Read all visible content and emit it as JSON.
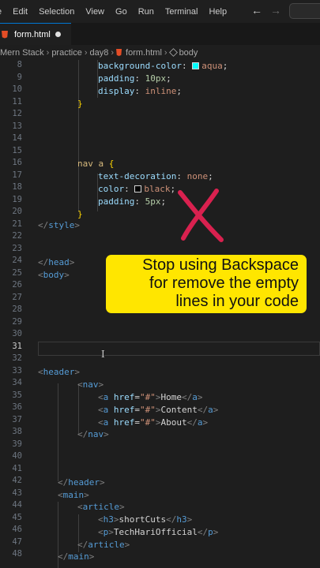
{
  "menu": {
    "items": [
      "e",
      "Edit",
      "Selection",
      "View",
      "Go",
      "Run",
      "Terminal",
      "Help"
    ],
    "back_icon": "arrow-left-icon",
    "forward_icon": "arrow-right-icon"
  },
  "tab": {
    "title": "form.html",
    "icon": "html5-icon",
    "modified": true
  },
  "breadcrumb": {
    "segments": [
      "Mern Stack",
      "practice",
      "day8",
      "form.html",
      "body"
    ]
  },
  "editor": {
    "active_line": 31,
    "line_numbers": [
      8,
      9,
      10,
      11,
      12,
      13,
      14,
      15,
      16,
      17,
      18,
      19,
      20,
      21,
      22,
      23,
      24,
      25,
      26,
      27,
      28,
      29,
      30,
      31,
      32,
      33,
      34,
      35,
      36,
      37,
      38,
      39,
      40,
      41,
      42,
      43,
      44,
      45,
      46,
      47,
      48
    ],
    "lines": {
      "l8": {
        "prop": "background-color",
        "colon": ": ",
        "value": "aqua",
        "swatch": "#00ffff",
        "end": ";"
      },
      "l9": {
        "prop": "padding",
        "colon": ": ",
        "value": "10px",
        "end": ";"
      },
      "l10": {
        "prop": "display",
        "colon": ": ",
        "value": "inline",
        "end": ";"
      },
      "l11": {
        "brace": "}"
      },
      "l15": {
        "selector": "nav a ",
        "brace": "{"
      },
      "l16": {
        "prop": "text-decoration",
        "colon": ": ",
        "value": "none",
        "end": ";"
      },
      "l17": {
        "prop": "color",
        "colon": ": ",
        "value": "black",
        "swatch": "#000000",
        "end": ";"
      },
      "l18": {
        "prop": "padding",
        "colon": ": ",
        "value": "5px",
        "end": ";"
      },
      "l19": {
        "brace": "}"
      },
      "l20": {
        "open": "</",
        "tag": "style",
        "close": ">"
      },
      "l22": {
        "open": "</",
        "tag": "head",
        "close": ">"
      },
      "l23": {
        "open": "<",
        "tag": "body",
        "close": ">"
      },
      "l32": {
        "open": "<",
        "tag": "header",
        "close": ">"
      },
      "l33": {
        "open": "<",
        "tag": "nav",
        "close": ">"
      },
      "links": [
        {
          "tag": "a",
          "attr": "href",
          "eq": "=",
          "val": "\"#\"",
          "text": "Home"
        },
        {
          "tag": "a",
          "attr": "href",
          "eq": "=",
          "val": "\"#\"",
          "text": "Content"
        },
        {
          "tag": "a",
          "attr": "href",
          "eq": "=",
          "val": "\"#\"",
          "text": "About"
        }
      ],
      "l37": {
        "open": "</",
        "tag": "nav",
        "close": ">"
      },
      "l42": {
        "open": "</",
        "tag": "header",
        "close": ">"
      },
      "l43": {
        "open": "<",
        "tag": "main",
        "close": ">"
      },
      "l44": {
        "open": "<",
        "tag": "article",
        "close": ">"
      },
      "l45": {
        "tag": "h3",
        "text": "shortCuts"
      },
      "l46": {
        "tag": "p",
        "text": "TechHariOfficial"
      },
      "l47": {
        "open": "</",
        "tag": "article",
        "close": ">"
      },
      "l48": {
        "open": "</",
        "tag": "main",
        "close": ">"
      }
    }
  },
  "overlay": {
    "caption": "Stop using Backspace\nfor remove the  empty\nlines in your code",
    "caption_color": "#ffe600",
    "mark_icon": "red-x-icon",
    "mark_color": "#d9214f"
  }
}
